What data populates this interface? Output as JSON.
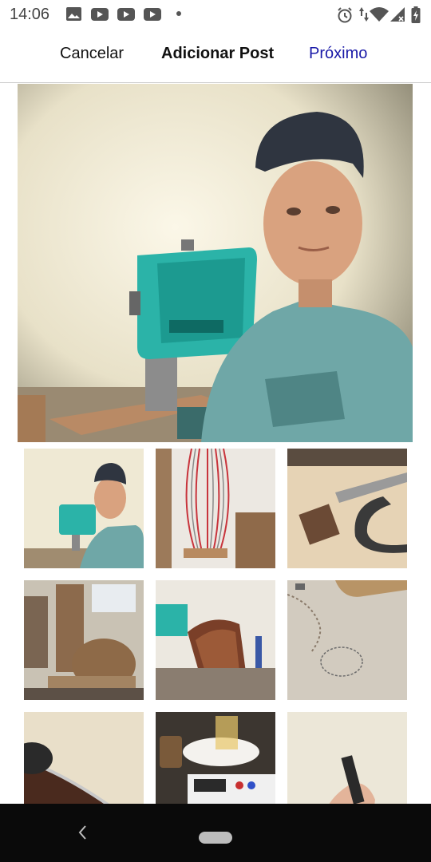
{
  "status_bar": {
    "time": "14:06",
    "notification_icons": [
      "image-icon",
      "youtube-icon",
      "youtube-icon",
      "youtube-icon",
      "dot-icon"
    ],
    "system_icons": [
      "alarm-icon",
      "data-arrows-icon",
      "wifi-icon",
      "signal-icon",
      "battery-icon"
    ]
  },
  "header": {
    "cancel_label": "Cancelar",
    "title": "Adicionar Post",
    "next_label": "Próximo"
  },
  "accent_color": "#1a1aa8",
  "gallery": {
    "selected_index": 0,
    "thumbnails": [
      "selfie-bandsaw",
      "guitar-strings-rack",
      "caliper-rosette",
      "bending-machine",
      "wood-bending-clamp",
      "guitar-top-template",
      "guitar-body-edge",
      "digital-scale",
      "hand-holding-part"
    ]
  },
  "navbar": {
    "back_icon": "chevron-left-icon",
    "home_icon": "home-pill-icon"
  }
}
